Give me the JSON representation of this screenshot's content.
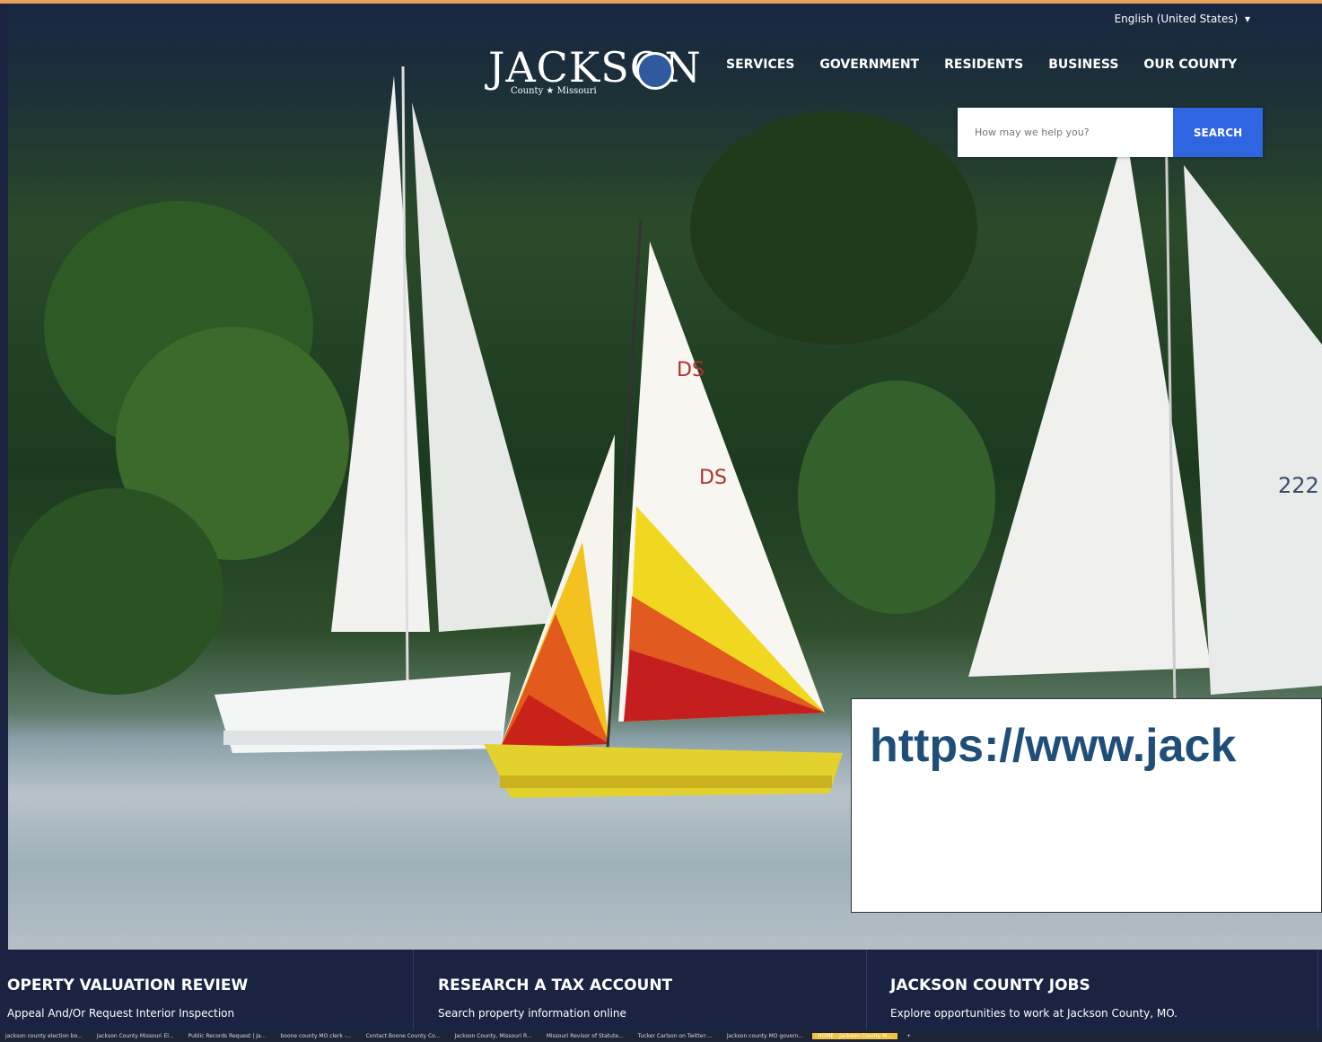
{
  "header": {
    "language": "English (United States)",
    "logo_word": "JACKSON",
    "logo_sub": "County ★ Missouri",
    "nav": [
      "SERVICES",
      "GOVERNMENT",
      "RESIDENTS",
      "BUSINESS",
      "OUR COUNTY"
    ]
  },
  "search": {
    "placeholder": "How may we help you?",
    "button": "SEARCH"
  },
  "callout": {
    "url_text": "https://www.jack"
  },
  "cards": [
    {
      "title": "OPERTY VALUATION REVIEW",
      "sub": "Appeal And/Or Request Interior Inspection"
    },
    {
      "title": "RESEARCH A TAX ACCOUNT",
      "sub": "Search property information online"
    },
    {
      "title": "JACKSON COUNTY JOBS",
      "sub": "Explore opportunities to work at Jackson County, MO."
    }
  ],
  "taskbar": {
    "tabs": [
      "jackson county election bo...",
      "Jackson County Missouri El...",
      "Public Records Request | Ja...",
      "boone county MO clerk -...",
      "Contact Boone County Co...",
      "Jackson County, Missouri R...",
      "Missouri Revisor of Statute...",
      "Tucker Carlson on Twitter:...",
      "jackson county MO govern...",
      "HOME - Jackson County M..."
    ],
    "active_index": 9
  },
  "colors": {
    "nav_bg": "#1a2442",
    "search_button": "#2f65e0",
    "callout_text": "#1f4e79"
  }
}
